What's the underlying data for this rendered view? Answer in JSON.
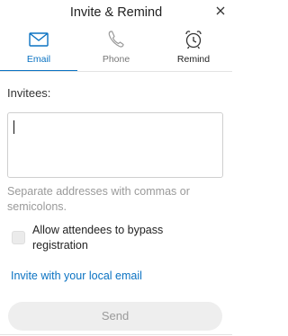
{
  "header": {
    "title": "Invite & Remind",
    "close_icon": "close-icon"
  },
  "tabs": [
    {
      "label": "Email",
      "icon": "envelope-icon",
      "active": true
    },
    {
      "label": "Phone",
      "icon": "phone-icon",
      "active": false
    },
    {
      "label": "Remind",
      "icon": "alarm-clock-icon",
      "active": false
    }
  ],
  "form": {
    "invitees_label": "Invitees:",
    "invitees_value": "",
    "hint": "Separate addresses with commas or semicolons.",
    "bypass_checkbox": {
      "label": "Allow attendees to bypass registration",
      "checked": false
    },
    "local_email_link": "Invite with your local email",
    "send_label": "Send"
  },
  "colors": {
    "accent": "#0a72c2",
    "muted_text": "#9a9a9a",
    "disabled_button_bg": "#eeeeee"
  }
}
